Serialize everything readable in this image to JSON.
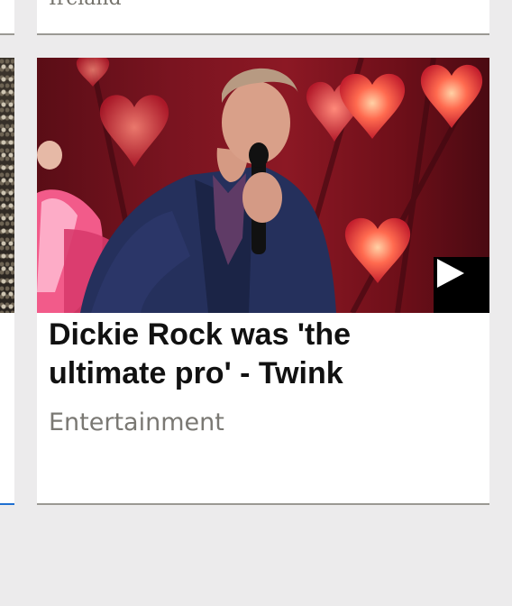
{
  "prev_card": {
    "text": "Ireland"
  },
  "article": {
    "headline": "Dickie Rock was 'the ultimate pro' - Twink",
    "category": "Entertainment",
    "thumbnail_icon": "play-icon"
  },
  "colors": {
    "background": "#ecebec",
    "card": "#ffffff",
    "divider": "#9b9994",
    "active_underline": "#1f6fd0",
    "headline": "#111111",
    "category": "#7a7873"
  }
}
